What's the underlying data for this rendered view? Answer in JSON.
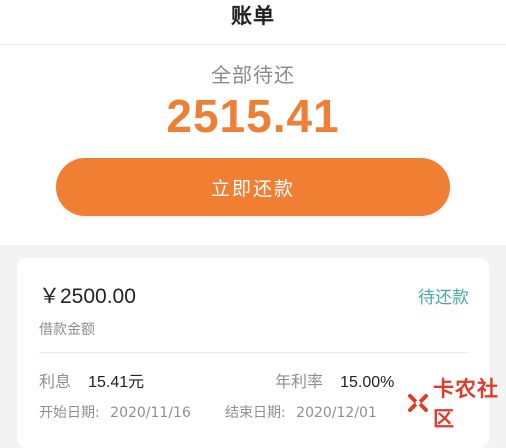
{
  "header": {
    "title": "账单"
  },
  "summary": {
    "label": "全部待还",
    "amount": "2515.41",
    "repay_button": "立即还款"
  },
  "card": {
    "principal": "￥2500.00",
    "status": "待还款",
    "principal_label": "借款金额",
    "interest_label": "利息",
    "interest_value": "15.41元",
    "rate_label": "年利率",
    "rate_value": "15.00%",
    "start_label": "开始日期:",
    "start_value": "2020/11/16",
    "end_label": "结束日期:",
    "end_value": "2020/12/01"
  },
  "watermark": {
    "text": "卡农社区"
  },
  "colors": {
    "accent": "#f07f33",
    "amount": "#ee7f36",
    "status": "#4aa8a6",
    "watermark": "#e23a2a"
  }
}
